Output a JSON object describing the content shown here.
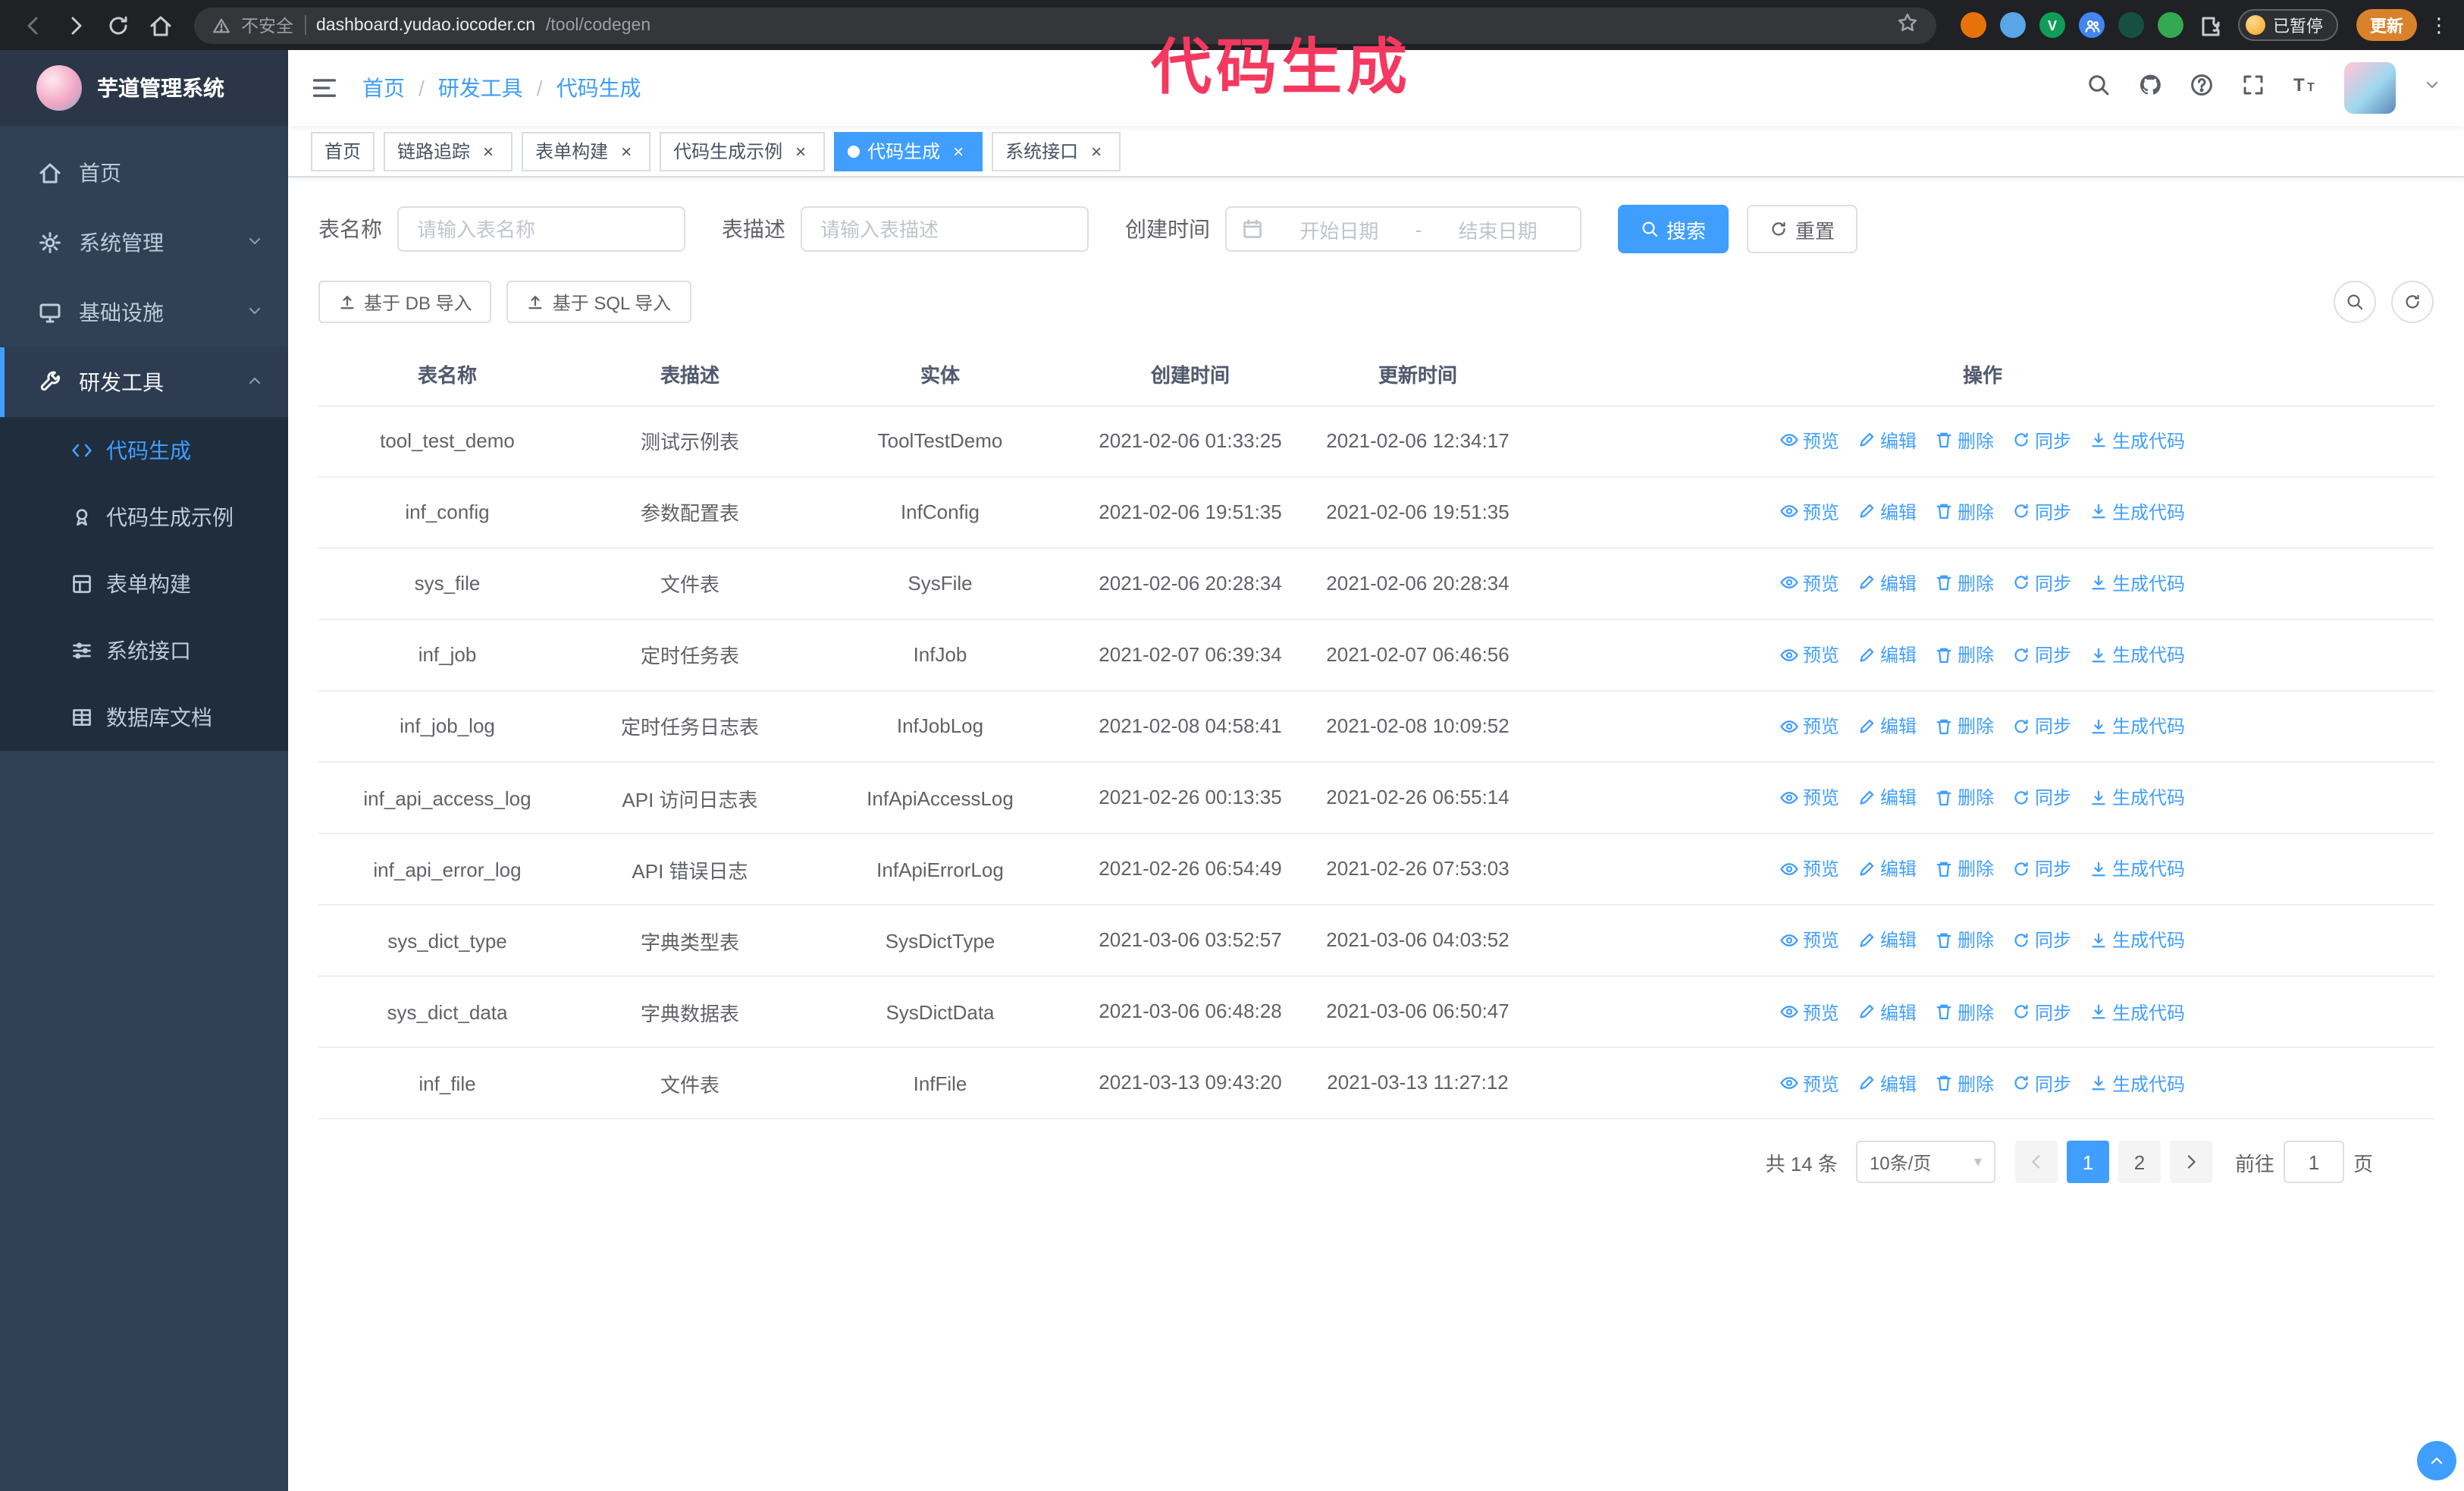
{
  "overlay": {
    "title": "代码生成"
  },
  "browser": {
    "security_label": "不安全",
    "url_host": "dashboard.yudao.iocoder.cn",
    "url_path": "/tool/codegen",
    "paused_badge": "已暂停",
    "update_button": "更新",
    "extension_icons": [
      "orange-extension-icon",
      "blue-extension-icon",
      "v-extension-icon",
      "people-extension-icon",
      "dark-extension-icon",
      "green-extension-icon",
      "puzzle-extensions-icon",
      "bookmark-star-icon"
    ]
  },
  "sidebar": {
    "app_title": "芋道管理系统",
    "items": [
      {
        "label": "首页",
        "icon": "home-icon"
      },
      {
        "label": "系统管理",
        "icon": "gear-icon",
        "state": "collapsed"
      },
      {
        "label": "基础设施",
        "icon": "monitor-icon",
        "state": "collapsed"
      },
      {
        "label": "研发工具",
        "icon": "tool-icon",
        "state": "expanded",
        "children": [
          {
            "label": "代码生成",
            "icon": "code-icon",
            "active": true
          },
          {
            "label": "代码生成示例",
            "icon": "medal-icon"
          },
          {
            "label": "表单构建",
            "icon": "form-icon"
          },
          {
            "label": "系统接口",
            "icon": "api-icon"
          },
          {
            "label": "数据库文档",
            "icon": "table-icon"
          }
        ]
      }
    ]
  },
  "header": {
    "breadcrumb": [
      "首页",
      "研发工具",
      "代码生成"
    ],
    "breadcrumb_separator": "/",
    "right_icons": [
      "search-icon",
      "github-icon",
      "help-icon",
      "fullscreen-icon",
      "font-size-icon",
      "avatar",
      "chevron-down-icon"
    ]
  },
  "tabs": [
    {
      "label": "首页",
      "closable": false,
      "active": false
    },
    {
      "label": "链路追踪",
      "closable": true,
      "active": false
    },
    {
      "label": "表单构建",
      "closable": true,
      "active": false
    },
    {
      "label": "代码生成示例",
      "closable": true,
      "active": false
    },
    {
      "label": "代码生成",
      "closable": true,
      "active": true
    },
    {
      "label": "系统接口",
      "closable": true,
      "active": false
    }
  ],
  "filters": {
    "table_name_label": "表名称",
    "table_name_placeholder": "请输入表名称",
    "table_desc_label": "表描述",
    "table_desc_placeholder": "请输入表描述",
    "create_time_label": "创建时间",
    "date_start_placeholder": "开始日期",
    "date_separator": "-",
    "date_end_placeholder": "结束日期",
    "search_button": "搜索",
    "reset_button": "重置"
  },
  "toolbar": {
    "import_db_button": "基于 DB 导入",
    "import_sql_button": "基于 SQL 导入",
    "right_buttons": [
      "toggle-search-icon",
      "refresh-icon"
    ]
  },
  "table": {
    "columns": [
      "表名称",
      "表描述",
      "实体",
      "创建时间",
      "更新时间",
      "操作"
    ],
    "actions": [
      {
        "label": "预览",
        "icon": "eye",
        "name": "preview"
      },
      {
        "label": "编辑",
        "icon": "edit",
        "name": "edit"
      },
      {
        "label": "删除",
        "icon": "trash",
        "name": "delete"
      },
      {
        "label": "同步",
        "icon": "sync",
        "name": "sync"
      },
      {
        "label": "生成代码",
        "icon": "download",
        "name": "generate-code"
      }
    ],
    "rows": [
      {
        "name": "tool_test_demo",
        "desc": "测试示例表",
        "entity": "ToolTestDemo",
        "created": "2021-02-06 01:33:25",
        "updated": "2021-02-06 12:34:17"
      },
      {
        "name": "inf_config",
        "desc": "参数配置表",
        "entity": "InfConfig",
        "created": "2021-02-06 19:51:35",
        "updated": "2021-02-06 19:51:35"
      },
      {
        "name": "sys_file",
        "desc": "文件表",
        "entity": "SysFile",
        "created": "2021-02-06 20:28:34",
        "updated": "2021-02-06 20:28:34"
      },
      {
        "name": "inf_job",
        "desc": "定时任务表",
        "entity": "InfJob",
        "created": "2021-02-07 06:39:34",
        "updated": "2021-02-07 06:46:56"
      },
      {
        "name": "inf_job_log",
        "desc": "定时任务日志表",
        "entity": "InfJobLog",
        "created": "2021-02-08 04:58:41",
        "updated": "2021-02-08 10:09:52"
      },
      {
        "name": "inf_api_access_log",
        "desc": "API 访问日志表",
        "entity": "InfApiAccessLog",
        "created": "2021-02-26 00:13:35",
        "updated": "2021-02-26 06:55:14"
      },
      {
        "name": "inf_api_error_log",
        "desc": "API 错误日志",
        "entity": "InfApiErrorLog",
        "created": "2021-02-26 06:54:49",
        "updated": "2021-02-26 07:53:03"
      },
      {
        "name": "sys_dict_type",
        "desc": "字典类型表",
        "entity": "SysDictType",
        "created": "2021-03-06 03:52:57",
        "updated": "2021-03-06 04:03:52"
      },
      {
        "name": "sys_dict_data",
        "desc": "字典数据表",
        "entity": "SysDictData",
        "created": "2021-03-06 06:48:28",
        "updated": "2021-03-06 06:50:47"
      },
      {
        "name": "inf_file",
        "desc": "文件表",
        "entity": "InfFile",
        "created": "2021-03-13 09:43:20",
        "updated": "2021-03-13 11:27:12"
      }
    ]
  },
  "pagination": {
    "total_text": "共 14 条",
    "page_size": "10条/页",
    "pages": [
      "1",
      "2"
    ],
    "active_page": "1",
    "goto_label": "前往",
    "goto_value": "1",
    "goto_suffix": "页"
  },
  "colors": {
    "accent": "#409eff",
    "sidebar_bg": "#304156",
    "submenu_bg": "#1f2d3d",
    "chrome_bg": "#202124",
    "overlay_text": "#f5385f",
    "update_button_bg": "#d9822b",
    "table_border": "#ebeef5"
  }
}
